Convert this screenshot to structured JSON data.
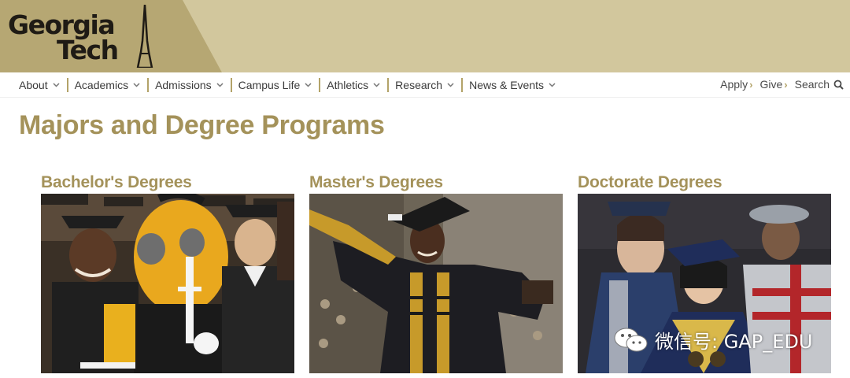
{
  "logo": {
    "line1": "Georgia",
    "line2": "Tech"
  },
  "nav": {
    "items": [
      {
        "label": "About"
      },
      {
        "label": "Academics"
      },
      {
        "label": "Admissions"
      },
      {
        "label": "Campus Life"
      },
      {
        "label": "Athletics"
      },
      {
        "label": "Research"
      },
      {
        "label": "News & Events"
      }
    ],
    "apply": "Apply",
    "give": "Give",
    "search": "Search"
  },
  "page_title": "Majors and Degree Programs",
  "degrees": [
    {
      "title": "Bachelor's Degrees"
    },
    {
      "title": "Master's Degrees"
    },
    {
      "title": "Doctorate Degrees"
    }
  ],
  "watermark": {
    "text": "微信号: GAP_EDU"
  },
  "colors": {
    "header_gold": "#c4b688",
    "title_gold": "#a4925a",
    "nav_separator": "#b3a369"
  }
}
